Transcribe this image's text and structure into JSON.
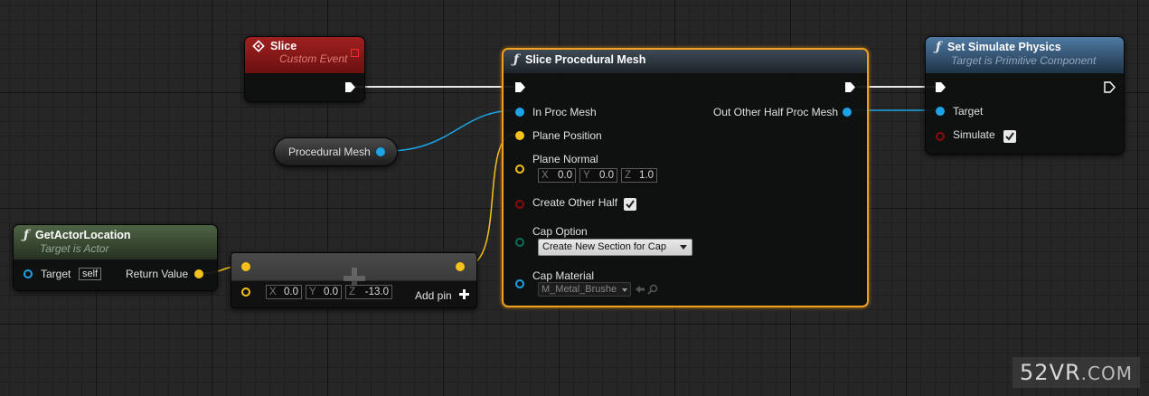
{
  "slice_event": {
    "title": "Slice",
    "subtitle": "Custom Event"
  },
  "procedural_mesh_var": {
    "label": "Procedural Mesh"
  },
  "get_actor_location": {
    "title": "GetActorLocation",
    "subtitle": "Target is Actor",
    "target_label": "Target",
    "target_value": "self",
    "return_label": "Return Value"
  },
  "make_vector": {
    "x": "0.0",
    "y": "0.0",
    "z": "-13.0",
    "add_pin": "Add pin",
    "axis_x": "X",
    "axis_y": "Y",
    "axis_z": "Z"
  },
  "slice_proc_mesh": {
    "title": "Slice Procedural Mesh",
    "in_proc_mesh": "In Proc Mesh",
    "out_other_half": "Out Other Half Proc Mesh",
    "plane_position": "Plane Position",
    "plane_normal": "Plane Normal",
    "normal_x": "0.0",
    "normal_y": "0.0",
    "normal_z": "1.0",
    "axis_x": "X",
    "axis_y": "Y",
    "axis_z": "Z",
    "create_other_half": "Create Other Half",
    "cap_option": "Cap Option",
    "cap_option_value": "Create New Section for Cap",
    "cap_material": "Cap Material",
    "cap_material_value": "M_Metal_Brushe"
  },
  "set_simulate": {
    "title": "Set Simulate Physics",
    "subtitle": "Target is Primitive Component",
    "target_label": "Target",
    "simulate_label": "Simulate"
  },
  "watermark": {
    "main": "52VR",
    "domain": ".COM"
  },
  "colors": {
    "object_pin": "#1da3e6",
    "vector_pin": "#f5c21c",
    "bool_pin": "#8a0b0b",
    "byte_pin": "#0d6b5b",
    "event_header": "#8e1a1a",
    "function_header": "#3c6185",
    "pure_header": "#415439",
    "selection": "#f0a020"
  }
}
